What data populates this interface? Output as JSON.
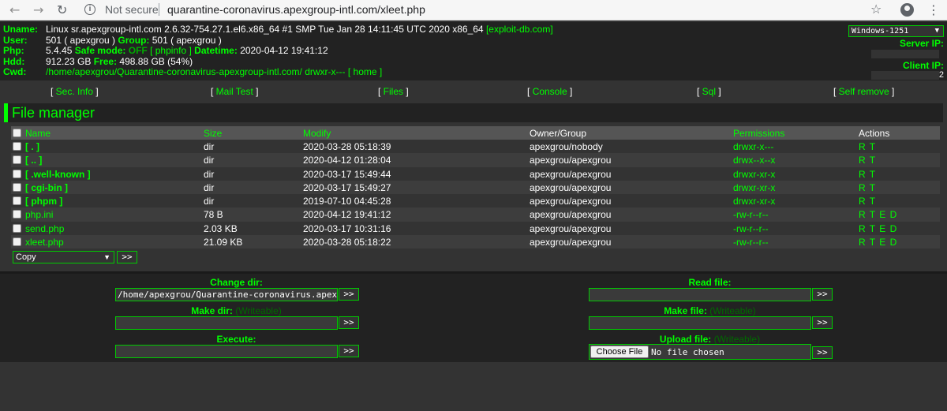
{
  "browser": {
    "not_secure": "Not secure",
    "url": "quarantine-coronavirus.apexgroup-intl.com/xleet.php"
  },
  "info": {
    "uname_label": "Uname:",
    "uname_value": "Linux sr.apexgroup-intl.com 2.6.32-754.27.1.el6.x86_64 #1 SMP Tue Jan 28 14:11:45 UTC 2020 x86_64",
    "exploit_link": "[exploit-db.com]",
    "user_label": "User:",
    "user_value": "501 ( apexgrou )",
    "group_label": "Group:",
    "group_value": "501 ( apexgrou )",
    "php_label": "Php:",
    "php_value": "5.4.45",
    "safe_mode_label": "Safe mode:",
    "safe_mode_value": "OFF",
    "phpinfo_link": "[ phpinfo ]",
    "datetime_label": "Datetime:",
    "datetime_value": "2020-04-12 19:41:12",
    "hdd_label": "Hdd:",
    "hdd_value": "912.23 GB",
    "free_label": "Free:",
    "free_value": "498.88 GB (54%)",
    "cwd_label": "Cwd:",
    "cwd_value": "/home/apexgrou/Quarantine-coronavirus-apexgroup-intl.com/",
    "cwd_perm": "drwxr-x---",
    "home_link": "[ home ]",
    "encoding": "Windows-1251",
    "server_ip_label": "Server IP:",
    "client_ip_label": "Client IP:",
    "client_ip_tail": "2"
  },
  "menu": [
    {
      "label": "Sec. Info"
    },
    {
      "label": "Mail Test"
    },
    {
      "label": "Files"
    },
    {
      "label": "Console"
    },
    {
      "label": "Sql"
    },
    {
      "label": "Self remove"
    }
  ],
  "file_manager": {
    "title": "File manager",
    "headers": {
      "name": "Name",
      "size": "Size",
      "modify": "Modify",
      "owner": "Owner/Group",
      "permissions": "Permissions",
      "actions": "Actions"
    },
    "rows": [
      {
        "name": "[ . ]",
        "size": "dir",
        "modify": "2020-03-28 05:18:39",
        "owner": "apexgrou/nobody",
        "perm": "drwxr-x---",
        "actions": "R T"
      },
      {
        "name": "[ .. ]",
        "size": "dir",
        "modify": "2020-04-12 01:28:04",
        "owner": "apexgrou/apexgrou",
        "perm": "drwx--x--x",
        "actions": "R T"
      },
      {
        "name": "[ .well-known ]",
        "size": "dir",
        "modify": "2020-03-17 15:49:44",
        "owner": "apexgrou/apexgrou",
        "perm": "drwxr-xr-x",
        "actions": "R T"
      },
      {
        "name": "[ cgi-bin ]",
        "size": "dir",
        "modify": "2020-03-17 15:49:27",
        "owner": "apexgrou/apexgrou",
        "perm": "drwxr-xr-x",
        "actions": "R T"
      },
      {
        "name": "[ phpm ]",
        "size": "dir",
        "modify": "2019-07-10 04:45:28",
        "owner": "apexgrou/apexgrou",
        "perm": "drwxr-xr-x",
        "actions": "R T"
      },
      {
        "name": "php.ini",
        "size": "78 B",
        "modify": "2020-04-12 19:41:12",
        "owner": "apexgrou/apexgrou",
        "perm": "-rw-r--r--",
        "actions": "R T E D"
      },
      {
        "name": "send.php",
        "size": "2.03 KB",
        "modify": "2020-03-17 10:31:16",
        "owner": "apexgrou/apexgrou",
        "perm": "-rw-r--r--",
        "actions": "R T E D"
      },
      {
        "name": "xleet.php",
        "size": "21.09 KB",
        "modify": "2020-03-28 05:18:22",
        "owner": "apexgrou/apexgrou",
        "perm": "-rw-r--r--",
        "actions": "R T E D"
      }
    ],
    "copy_option": "Copy",
    "go_label": ">>"
  },
  "forms": {
    "change_dir_label": "Change dir:",
    "change_dir_value": "/home/apexgrou/Quarantine-coronavirus.apexgroup-intl.com/",
    "make_dir_label": "Make dir:",
    "execute_label": "Execute:",
    "read_file_label": "Read file:",
    "make_file_label": "Make file:",
    "upload_file_label": "Upload file:",
    "writeable": "(Writeable)",
    "choose_file": "Choose File",
    "no_file": "No file chosen",
    "go_label": ">>"
  }
}
